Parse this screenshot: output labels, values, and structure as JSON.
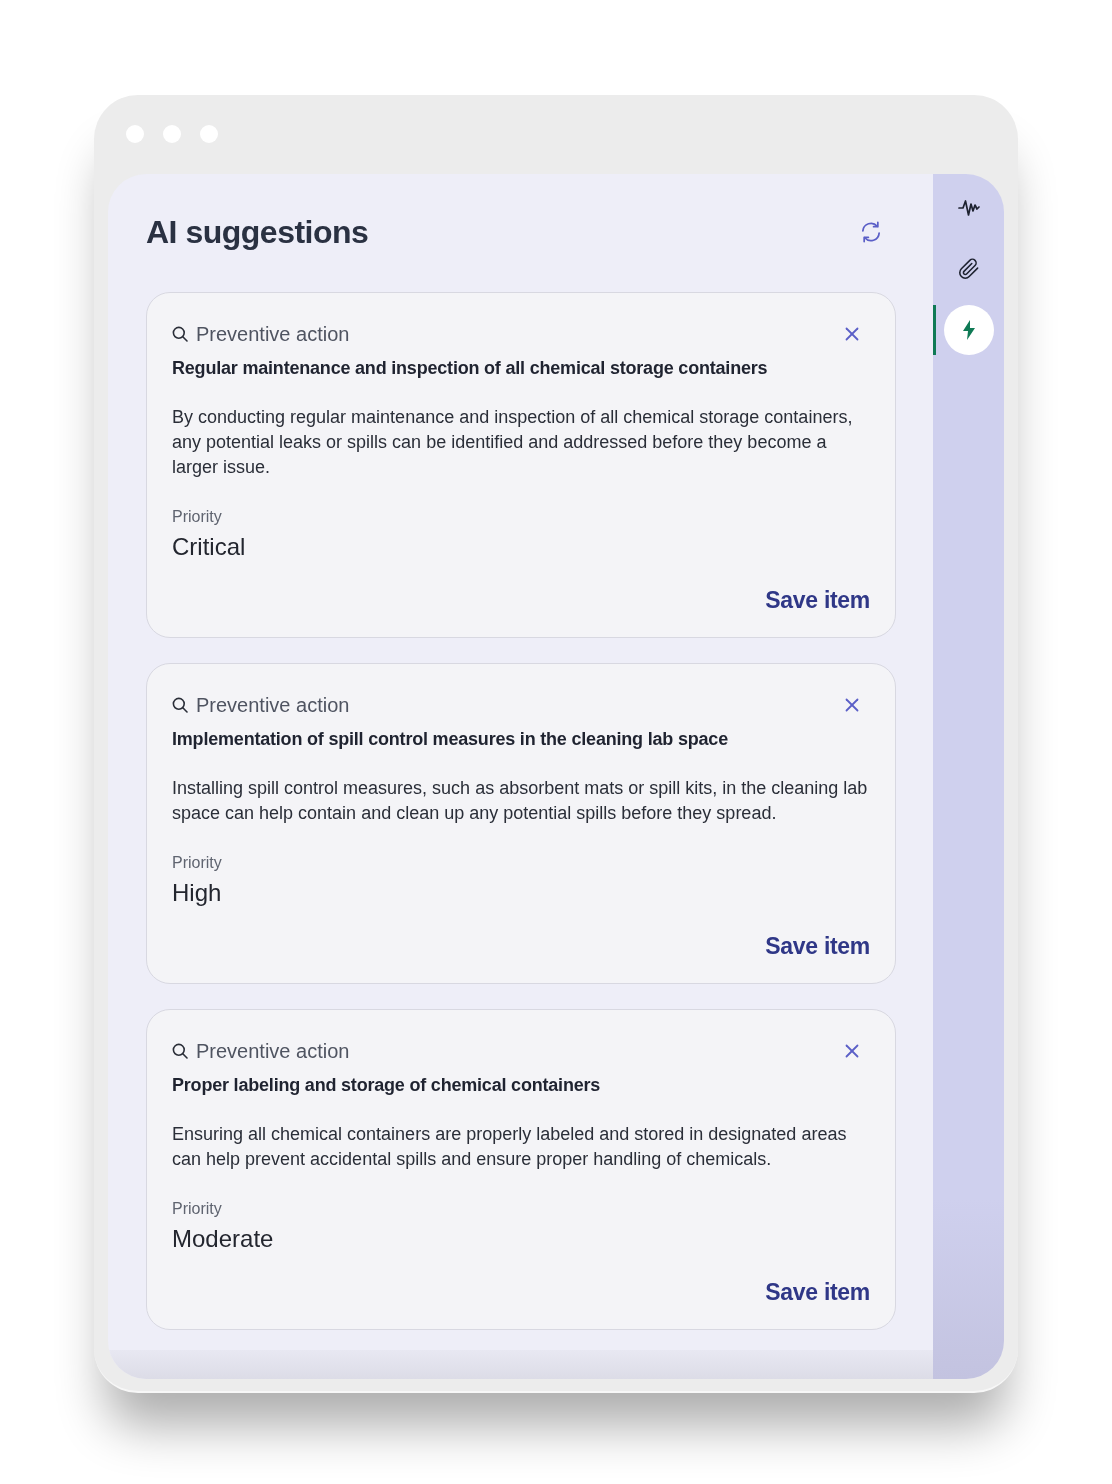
{
  "panel": {
    "title": "AI suggestions"
  },
  "sidebar": {
    "items": [
      {
        "kind": "activity",
        "selected": false
      },
      {
        "kind": "attachment",
        "selected": false
      },
      {
        "kind": "ai",
        "selected": true
      }
    ]
  },
  "suggestions": [
    {
      "category": "Preventive action",
      "title": "Regular maintenance and inspection of all chemical storage containers",
      "description": "By conducting regular maintenance and inspection of all chemical storage containers, any potential leaks or spills can be identified and addressed before they become a larger issue.",
      "priority_label": "Priority",
      "priority": "Critical",
      "action": "Save item"
    },
    {
      "category": "Preventive action",
      "title": "Implementation of spill control measures in the cleaning lab space",
      "description": "Installing spill control measures, such as absorbent mats or spill kits, in the cleaning lab space can help contain and clean up any potential spills before they spread.",
      "priority_label": "Priority",
      "priority": "High",
      "action": "Save item"
    },
    {
      "category": "Preventive action",
      "title": "Proper labeling and storage of chemical containers",
      "description": "Ensuring all chemical containers are properly labeled and stored in designated areas can help prevent accidental spills and ensure proper handling of chemicals.",
      "priority_label": "Priority",
      "priority": "Moderate",
      "action": "Save item"
    }
  ]
}
